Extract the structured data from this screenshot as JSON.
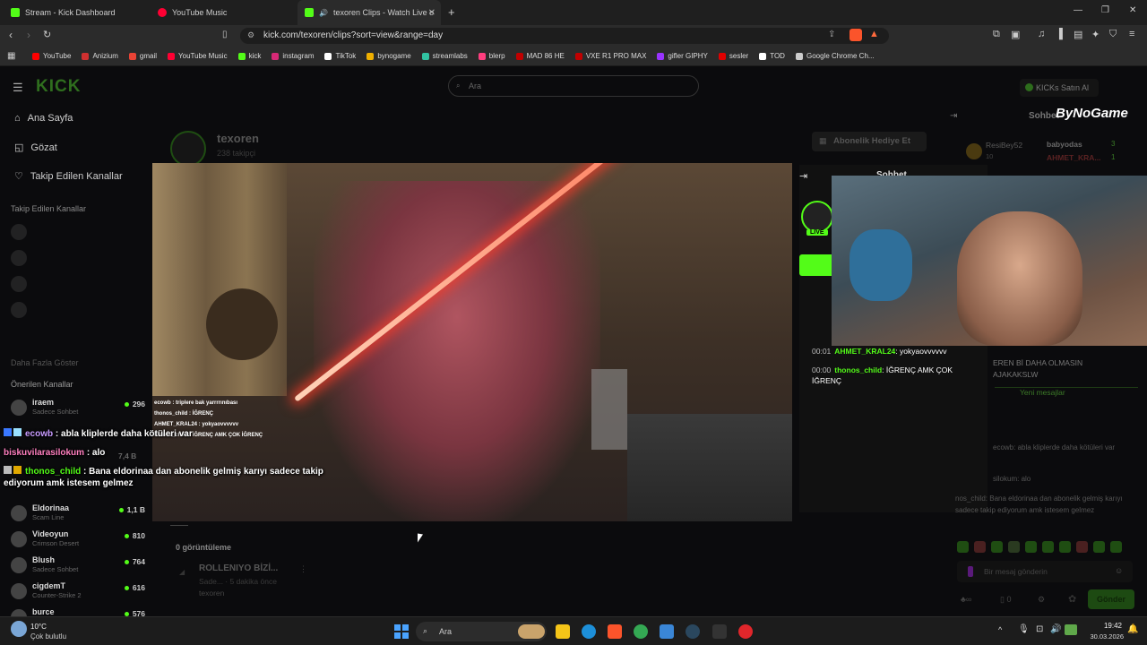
{
  "browser": {
    "tabs": [
      {
        "label": "Stream - Kick Dashboard",
        "color": "#53fc18"
      },
      {
        "label": "YouTube Music",
        "color": "#ff0033"
      },
      {
        "label": "texoren Clips - Watch Live on",
        "color": "#53fc18"
      }
    ],
    "url": "kick.com/texoren/clips?sort=view&range=day",
    "bookmarks": [
      {
        "label": "YouTube",
        "color": "#ff0000"
      },
      {
        "label": "Anizium",
        "color": "#d03030"
      },
      {
        "label": "gmail",
        "color": "#ea4335"
      },
      {
        "label": "YouTube Music",
        "color": "#ff0033"
      },
      {
        "label": "kick",
        "color": "#53fc18"
      },
      {
        "label": "instagram",
        "color": "#d62976"
      },
      {
        "label": "TikTok",
        "color": "#ffffff"
      },
      {
        "label": "bynogame",
        "color": "#f0b000"
      },
      {
        "label": "streamlabs",
        "color": "#31c3a2"
      },
      {
        "label": "blerp",
        "color": "#ff3e7f"
      },
      {
        "label": "MAD 86 HE",
        "color": "#c00000"
      },
      {
        "label": "VXE R1 PRO MAX",
        "color": "#c00000"
      },
      {
        "label": "gifler GIPHY",
        "color": "#9933ff"
      },
      {
        "label": "sesler",
        "color": "#e00000"
      },
      {
        "label": "TOD",
        "color": "#ffffff"
      },
      {
        "label": "Google Chrome Ch...",
        "color": "#cccccc"
      }
    ]
  },
  "kick": {
    "search_placeholder": "Ara",
    "buy_kicks": "KICKs Satın Al",
    "nav": [
      "Ana Sayfa",
      "Gözat",
      "Takip Edilen Kanallar"
    ],
    "followed_title": "Takip Edilen Kanallar",
    "show_more": "Daha Fazla Göster",
    "recommended_title": "Önerilen Kanallar",
    "recommended": [
      {
        "name": "iraem",
        "category": "Sadece Sohbet",
        "viewers": "296"
      },
      {
        "name": "Eldorinaa",
        "category": "Scam Line",
        "viewers": "1,1 B"
      },
      {
        "name": "Videoyun",
        "category": "Crimson Desert",
        "viewers": "810"
      },
      {
        "name": "Blush",
        "category": "Sadece Sohbet",
        "viewers": "764"
      },
      {
        "name": "cigdemT",
        "category": "Counter-Strike 2",
        "viewers": "616"
      },
      {
        "name": "burce",
        "category": "",
        "viewers": "576"
      }
    ],
    "partial_viewers": "7,4 B",
    "channel_name": "texoren",
    "followers": "238 takipçi",
    "gift_sub": "Abonelik Hediye Et",
    "live_badge": "LIVE",
    "clip_views": "0 görüntüleme",
    "clip_title": "ROLLENIYO BİZİ...",
    "clip_meta": "Sade... · 5 dakika önce",
    "clip_author": "texoren",
    "chat_title_right": "Sohbet",
    "chat_title_overlay": "Sohbet",
    "brand_logo": "ByNoGame",
    "right_users": [
      {
        "name": "ResiBey52",
        "count": "10"
      },
      {
        "name": "babyodas",
        "count": "3"
      },
      {
        "name": "AHMET_KRA...",
        "count": "1"
      }
    ],
    "right_chat": [
      "EREN Bİ DAHA OLMASIN",
      "AJAKAKSLW",
      "Yeni mesajlar",
      "ecowb: abla kliplerde daha kötüleri var",
      "silokum: alo",
      "nos_child: Bana eldorinaa dan abonelik gelmiş karıyı sadece takip ediyorum amk istesem gelmez"
    ],
    "message_placeholder": "Bir mesaj gönderin",
    "send_button": "Gönder",
    "bottom_count": "0"
  },
  "overlay_chat": {
    "small": [
      "ecowb : triplere bak yarrrrınıbası",
      "thonos_child : İĞRENÇ",
      "AHMET_KRAL24 : yokyaovvvvvv",
      "thonos_child : İĞRENÇ AMK ÇOK İĞRENÇ"
    ],
    "large": [
      {
        "user": "ecowb",
        "text": " : abla kliplerde daha kötüleri var",
        "user_color": "#c89bff"
      },
      {
        "user": "biskuvilarasilokum",
        "text": " : alo",
        "user_color": "#ff7fbf"
      },
      {
        "user": "thonos_child",
        "text": " : Bana eldorinaa dan abonelik gelmiş karıyı sadece takip ediyorum amk istesem gelmez",
        "user_color": "#53fc18"
      }
    ],
    "panel_messages": [
      {
        "time": "00:01",
        "user": "AHMET_KRAL24",
        "text": ": yokyaovvvvvv"
      },
      {
        "time": "00:00",
        "user": "thonos_child",
        "text": ": İĞRENÇ AMK ÇOK İĞRENÇ"
      }
    ]
  },
  "taskbar": {
    "search": "Ara",
    "weather_temp": "10°C",
    "weather_desc": "Çok bulutlu",
    "time": "19:42",
    "date": "30.03.2026"
  }
}
